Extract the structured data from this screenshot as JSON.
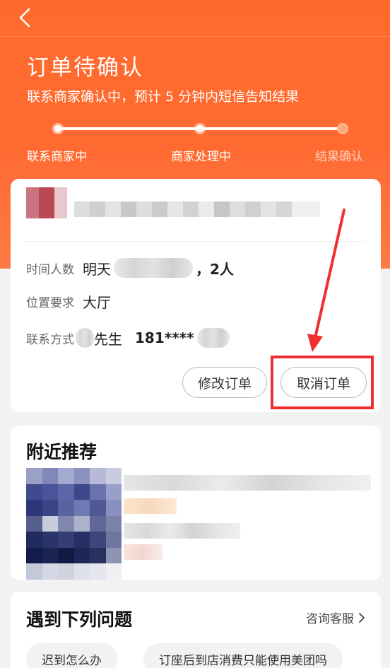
{
  "header": {
    "title": "订单待确认",
    "subtitle": "联系商家确认中，预计 5 分钟内短信告知结果",
    "steps": [
      {
        "label": "联系商家中",
        "state": "done"
      },
      {
        "label": "商家处理中",
        "state": "done"
      },
      {
        "label": "结果确认",
        "state": "pending"
      }
    ],
    "progress_fraction": 1.0
  },
  "order": {
    "time_label": "时间人数",
    "time_value": "明天",
    "people_value": "，2人",
    "location_label": "位置要求",
    "location_value": "大厅",
    "contact_label": "联系方式",
    "contact_name_suffix": "先生",
    "contact_phone": "181****",
    "modify_button": "修改订单",
    "cancel_button": "取消订单"
  },
  "nearby": {
    "title": "附近推荐"
  },
  "faq": {
    "title": "遇到下列问题",
    "service_link": "咨询客服",
    "chips": [
      "迟到怎么办",
      "订座后到店消费只能使用美团吗"
    ]
  },
  "colors": {
    "brand_orange": "#ff6a2c",
    "annotation_red": "#ef2f2f"
  },
  "icons": {
    "back": "chevron-left-icon",
    "link_arrow": "chevron-right-icon"
  }
}
